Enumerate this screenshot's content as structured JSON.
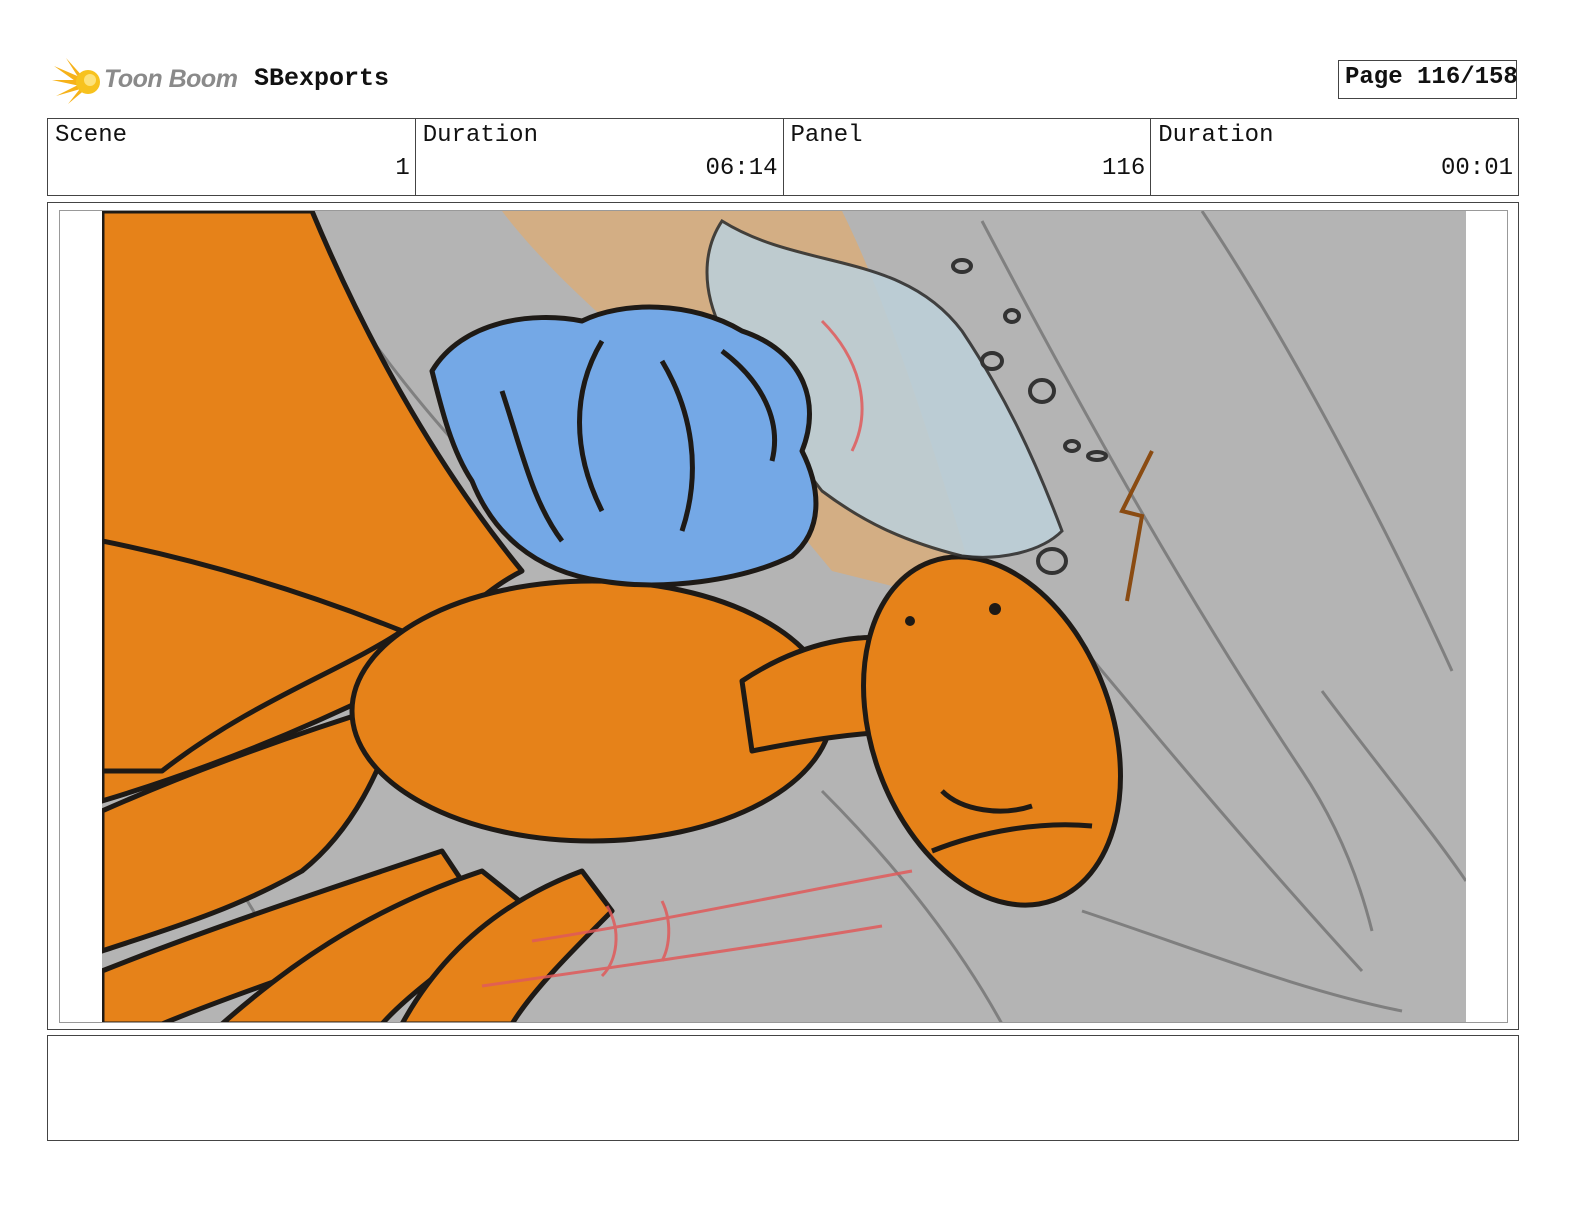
{
  "header": {
    "logo_text": "Toon Boom",
    "project_name": "SBexports",
    "page_label": "Page 116/158"
  },
  "info": [
    {
      "label": "Scene",
      "value": "1"
    },
    {
      "label": "Duration",
      "value": "06:14"
    },
    {
      "label": "Panel",
      "value": "116"
    },
    {
      "label": "Duration",
      "value": "00:01"
    }
  ],
  "panel": {
    "colors": {
      "background": "#b4b4b4",
      "creature": "#e68219",
      "character": "#74a8e6",
      "splash": "#bccfd8",
      "arm": "#d6ad7e",
      "ink": "#1e1a16",
      "red_marks": "#e05a5a"
    }
  },
  "notes": {
    "text": ""
  }
}
